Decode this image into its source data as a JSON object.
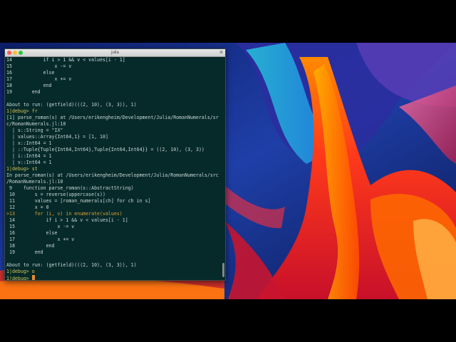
{
  "window": {
    "title": "julia",
    "size_label": "⌘"
  },
  "terminal": {
    "lines": [
      {
        "text": "14           if i > 1 && v < values[i - 1]"
      },
      {
        "text": "15               x -= v"
      },
      {
        "text": "16           else"
      },
      {
        "text": "17               x += v"
      },
      {
        "text": "18           end"
      },
      {
        "text": "19       end"
      },
      {
        "text": ""
      },
      {
        "text": "About to run: (getfield)(((2, 10), (3, 3)), 1)"
      },
      {
        "text": "1|debug> fr"
      },
      {
        "text": "[1] parse_roman(s) at /Users/erikengheim/Development/Julia/RomanNumerals/sr"
      },
      {
        "text": "c/RomanNumerals.jl:10"
      },
      {
        "text": "  | s::String = \"IX\""
      },
      {
        "text": "  | values::Array{Int64,1} = [1, 10]"
      },
      {
        "text": "  | x::Int64 = 1"
      },
      {
        "text": "  | ::Tuple{Tuple{Int64,Int64},Tuple{Int64,Int64}} = ((2, 10), (3, 3))"
      },
      {
        "text": "  | i::Int64 = 1"
      },
      {
        "text": "  | v::Int64 = 1"
      },
      {
        "text": "1|debug> st"
      },
      {
        "text": "In parse_roman(s) at /Users/erikengheim/Development/Julia/RomanNumerals/src"
      },
      {
        "text": "/RomanNumerals.jl:10"
      },
      {
        "text": " 9    function parse_roman(s::AbstractString)"
      },
      {
        "text": " 10       s = reverse(uppercase(s))"
      },
      {
        "text": " 11       values = [roman_numerals[ch] for ch in s]"
      },
      {
        "text": " 12       x = 0"
      },
      {
        "text": ">13       for (i, v) in enumerate(values)"
      },
      {
        "text": " 14           if i > 1 && v < values[i - 1]"
      },
      {
        "text": " 15               x -= v"
      },
      {
        "text": " 16           else"
      },
      {
        "text": " 17               x += v"
      },
      {
        "text": " 18           end"
      },
      {
        "text": " 19       end"
      },
      {
        "text": ""
      },
      {
        "text": "About to run: (getfield)(((2, 10), (3, 3)), 1)"
      },
      {
        "text": "1|debug> o"
      },
      {
        "text": "1|debug> "
      }
    ]
  },
  "colors": {
    "terminal_bg": "#062a2a",
    "prompt": "#d6c35a",
    "keyword": "#2f9fd6",
    "cursor": "#e58b2e"
  }
}
